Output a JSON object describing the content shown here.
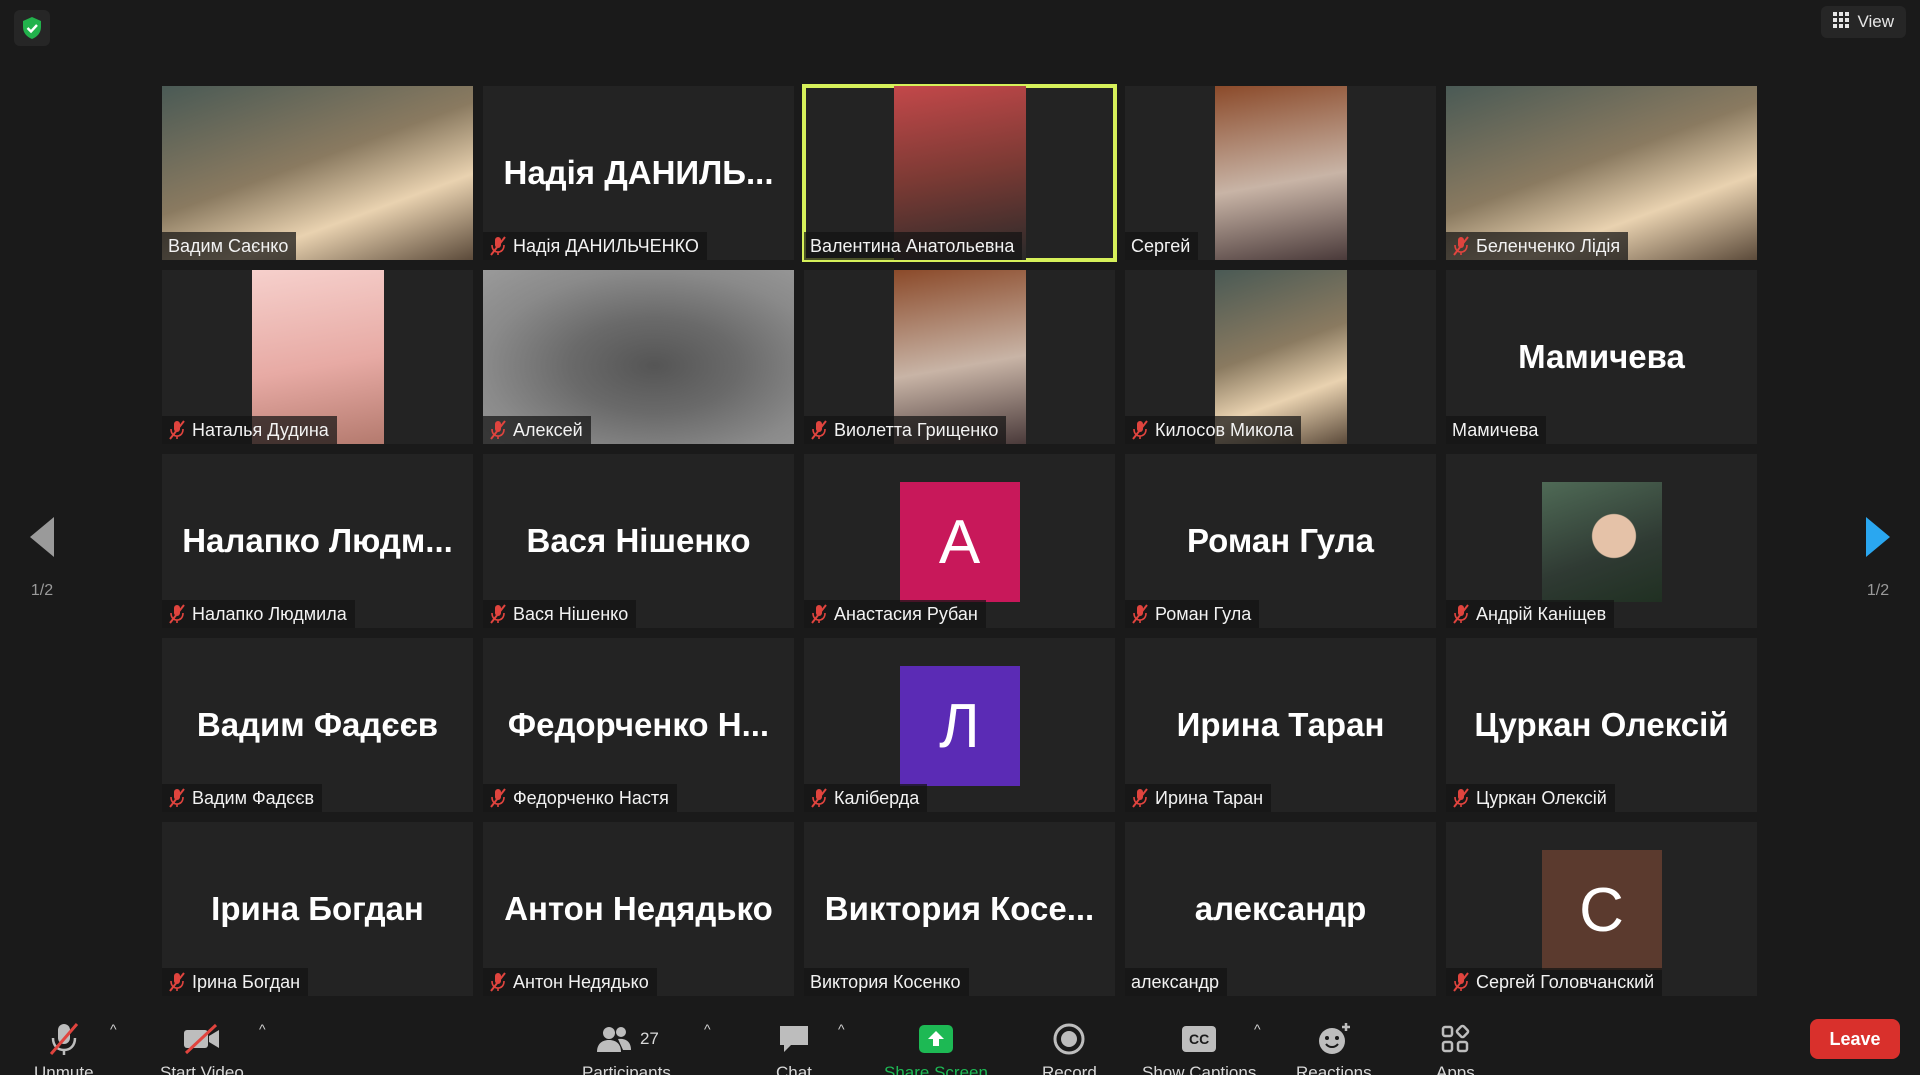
{
  "header": {
    "view_label": "View"
  },
  "navigation": {
    "page_indicator_left": "1/2",
    "page_indicator_right": "1/2"
  },
  "participants": [
    {
      "label": "Вадим Саєнко",
      "big": "",
      "muted": false,
      "video": "img",
      "active": false
    },
    {
      "label": "Надія ДАНИЛЬЧЕНКО",
      "big": "Надія ДАНИЛЬ...",
      "muted": true,
      "video": "none",
      "active": false
    },
    {
      "label": "Валентина Анатольевна",
      "big": "",
      "muted": false,
      "video": "img",
      "active": true
    },
    {
      "label": "Сергей",
      "big": "",
      "muted": false,
      "video": "img",
      "active": false
    },
    {
      "label": "Беленченко Лідія",
      "big": "",
      "muted": true,
      "video": "img",
      "active": false
    },
    {
      "label": "Наталья Дудина",
      "big": "",
      "muted": true,
      "video": "img",
      "active": false
    },
    {
      "label": "Алексей",
      "big": "",
      "muted": true,
      "video": "blur",
      "active": false
    },
    {
      "label": "Виолетта Грищенко",
      "big": "",
      "muted": true,
      "video": "img",
      "active": false
    },
    {
      "label": "Килосов Микола",
      "big": "",
      "muted": true,
      "video": "img",
      "active": false
    },
    {
      "label": "Мамичева",
      "big": "Мамичева",
      "muted": false,
      "video": "none",
      "active": false
    },
    {
      "label": "Налапко Людмила",
      "big": "Налапко  Людм...",
      "muted": true,
      "video": "none",
      "active": false
    },
    {
      "label": "Вася Нішенко",
      "big": "Вася Нішенко",
      "muted": true,
      "video": "none",
      "active": false
    },
    {
      "label": "Анастасия Рубан",
      "big": "",
      "muted": true,
      "video": "avatar",
      "avatar_letter": "A",
      "avatar_color": "#c8185a",
      "active": false
    },
    {
      "label": "Роман Гула",
      "big": "Роман Гула",
      "muted": true,
      "video": "none",
      "active": false
    },
    {
      "label": "Андрій Каніщев",
      "big": "",
      "muted": true,
      "video": "photo",
      "active": false
    },
    {
      "label": "Вадим Фадєєв",
      "big": "Вадим Фадєєв",
      "muted": true,
      "video": "none",
      "active": false
    },
    {
      "label": "Федорченко Настя",
      "big": "Федорченко  Н...",
      "muted": true,
      "video": "none",
      "active": false
    },
    {
      "label": "Каліберда",
      "big": "",
      "muted": true,
      "video": "avatar",
      "avatar_letter": "Л",
      "avatar_color": "#5b2bb5",
      "active": false
    },
    {
      "label": "Ирина Таран",
      "big": "Ирина Таран",
      "muted": true,
      "video": "none",
      "active": false
    },
    {
      "label": "Цуркан Олексій",
      "big": "Цуркан Олексій",
      "muted": true,
      "video": "none",
      "active": false
    },
    {
      "label": "Ірина Богдан",
      "big": "Ірина Богдан",
      "muted": true,
      "video": "none",
      "active": false
    },
    {
      "label": "Антон Недядько",
      "big": "Антон Недядько",
      "muted": true,
      "video": "none",
      "active": false
    },
    {
      "label": "Виктория Косенко",
      "big": "Виктория  Косе...",
      "muted": false,
      "video": "none",
      "active": false
    },
    {
      "label": "александр",
      "big": "александр",
      "muted": false,
      "video": "none",
      "active": false
    },
    {
      "label": "Сергей Головчанский",
      "big": "",
      "muted": true,
      "video": "avatar",
      "avatar_letter": "С",
      "avatar_color": "#5b3a2e",
      "active": false
    }
  ],
  "toolbar": {
    "unmute": "Unmute",
    "start_video": "Start Video",
    "participants": "Participants",
    "participants_count": "27",
    "chat": "Chat",
    "share_screen": "Share Screen",
    "record": "Record",
    "show_captions": "Show Captions",
    "reactions": "Reactions",
    "apps": "Apps",
    "leave": "Leave",
    "cc_text": "CC"
  },
  "colors": {
    "active_border": "#d6f05a",
    "share_green": "#1db954",
    "leave_red": "#d9302c",
    "mute_red": "#e0443e"
  }
}
